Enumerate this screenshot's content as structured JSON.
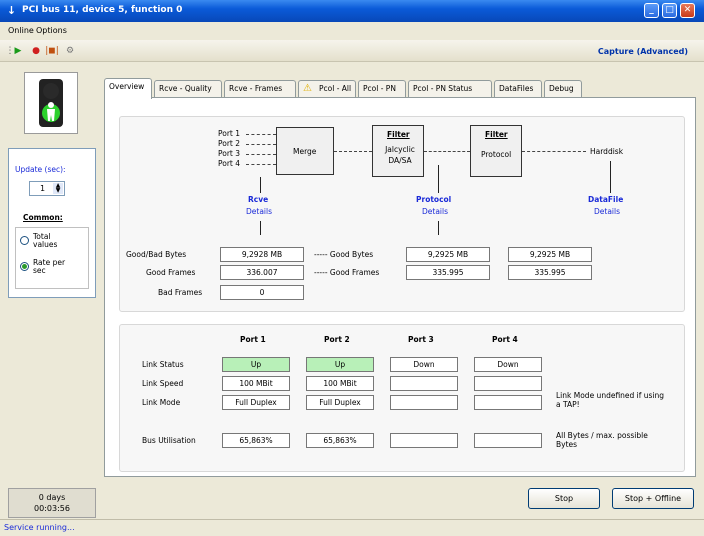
{
  "window": {
    "title": "PCI bus 11, device 5, function 0"
  },
  "menu": [
    "Online",
    "Options"
  ],
  "toolbar": {
    "capture_label": "Capture (Advanced)"
  },
  "left": {
    "update_label": "Update (sec):",
    "update_value": "1",
    "common_label": "Common:",
    "radio_total": "Total values",
    "radio_rate": "Rate per sec",
    "time_days": "0 days",
    "time_clock": "00:03:56"
  },
  "tabs": [
    "Overview",
    "Rcve - Quality",
    "Rcve - Frames",
    "Pcol - All",
    "Pcol - PN",
    "Pcol - PN Status",
    "DataFiles",
    "Debug"
  ],
  "pipeline": {
    "ports": [
      "Port 1",
      "Port 2",
      "Port 3",
      "Port 4"
    ],
    "merge": "Merge",
    "filter1_title": "Filter",
    "filter1_body": "Jalcyclic DA/SA",
    "filter2_title": "Filter",
    "filter2_body": "Protocol",
    "harddisk": "Harddisk",
    "rcve_title": "Rcve",
    "rcve_details": "Details",
    "protocol_title": "Protocol",
    "protocol_details": "Details",
    "datafile_title": "DataFile",
    "datafile_details": "Details"
  },
  "stats": {
    "label_goodbad": "Good/Bad Bytes",
    "label_goodframes": "Good Frames",
    "label_badframes": "Bad Frames",
    "rcve_bytes": "9,2928 MB",
    "rcve_frames": "336.007",
    "rcve_bad": "0",
    "label_goodbytes2": "----- Good Bytes",
    "label_goodframes2": "----- Good Frames",
    "proto_bytes": "9,2925 MB",
    "proto_frames": "335.995",
    "file_bytes": "9,2925 MB",
    "file_frames": "335.995"
  },
  "ports_table": {
    "headers": [
      "Port 1",
      "Port 2",
      "Port 3",
      "Port 4"
    ],
    "row_labels": [
      "Link Status",
      "Link Speed",
      "Link Mode",
      "Bus Utilisation"
    ],
    "link_status": [
      "Up",
      "Up",
      "Down",
      "Down"
    ],
    "link_speed": [
      "100 MBit",
      "100 MBit",
      "",
      ""
    ],
    "link_mode": [
      "Full Duplex",
      "Full Duplex",
      "",
      ""
    ],
    "bus_util": [
      "65,863%",
      "65,863%",
      "",
      ""
    ],
    "note_mode": "Link Mode undefined if using a TAP!",
    "note_util": "All Bytes / max. possible Bytes"
  },
  "buttons": {
    "stop": "Stop",
    "stop_offline": "Stop + Offline"
  },
  "status": "Service running..."
}
